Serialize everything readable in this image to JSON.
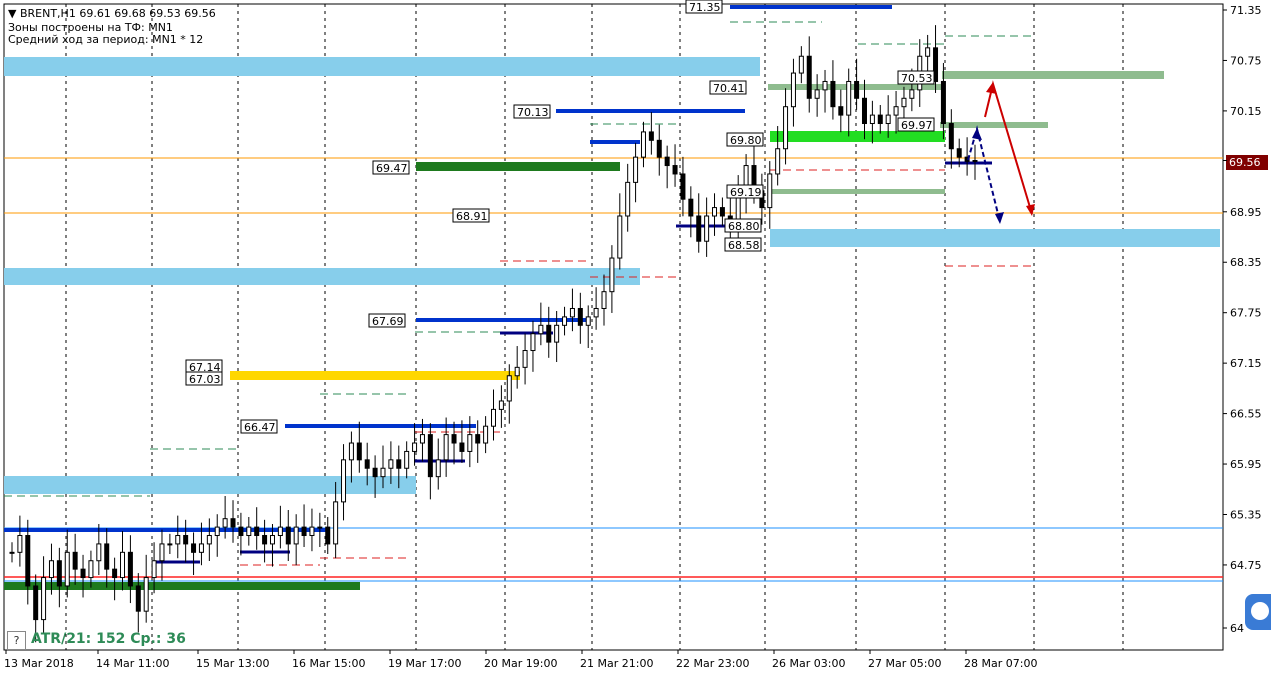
{
  "header": {
    "symbol_line": "BRENT,H1  69.61 69.68 69.53 69.56",
    "zones_line": "Зоны построены на ТФ: MN1",
    "avg_line": "Средний ход за период: MN1 * 12"
  },
  "atr_text": "ATR/21: 152  Ср.: 36",
  "help_box": "?",
  "colors": {
    "up_candle": "#000000",
    "grid": "#000000",
    "sky_zone": "#87ceeb",
    "dark_green_zone": "#1e7a1e",
    "lime_zone": "#22dd22",
    "sage_zone": "#8fbc8f",
    "gold_zone": "#ffd700",
    "blue_level": "#0033cc",
    "orange_line": "#ff9900",
    "red_line": "#ff2222",
    "price_box": "#800000",
    "arrow_red": "#cc0000",
    "arrow_blue": "#000080"
  },
  "chart_data": {
    "type": "candlestick",
    "symbol": "BRENT",
    "timeframe": "H1",
    "ylim": [
      63.95,
      71.4
    ],
    "y_ticks": [
      "71.35",
      "70.75",
      "70.15",
      "69.56",
      "68.95",
      "68.35",
      "67.75",
      "67.15",
      "66.55",
      "65.95",
      "65.35",
      "64.75",
      "64"
    ],
    "x_ticks": [
      "13 Mar 2018",
      "14 Mar 11:00",
      "15 Mar 13:00",
      "16 Mar 15:00",
      "19 Mar 17:00",
      "20 Mar 19:00",
      "21 Mar 21:00",
      "22 Mar 23:00",
      "26 Mar 03:00",
      "27 Mar 05:00",
      "28 Mar 07:00"
    ],
    "current_price": "69.56",
    "price_labels": [
      "71.35",
      "70.41",
      "70.13",
      "69.47",
      "69.80",
      "69.97",
      "70.53",
      "69.19",
      "68.91",
      "68.80",
      "68.58",
      "67.69",
      "67.14",
      "67.03",
      "66.47"
    ],
    "ohlc_path": [
      64.9,
      65.1,
      64.5,
      64.1,
      64.6,
      64.8,
      64.5,
      64.9,
      64.7,
      64.6,
      64.8,
      65.0,
      64.7,
      64.6,
      64.9,
      64.5,
      64.2,
      64.6,
      64.8,
      65.0,
      65.0,
      65.1,
      65.0,
      64.9,
      65.0,
      65.1,
      65.2,
      65.3,
      65.2,
      65.1,
      65.2,
      65.1,
      65.0,
      65.1,
      65.2,
      65.0,
      65.2,
      65.1,
      65.2,
      65.2,
      65.0,
      65.5,
      66.0,
      66.2,
      66.0,
      65.9,
      65.8,
      65.9,
      66.0,
      65.9,
      66.1,
      66.2,
      66.3,
      65.8,
      66.0,
      66.3,
      66.2,
      66.1,
      66.3,
      66.2,
      66.4,
      66.6,
      66.7,
      67.0,
      67.1,
      67.3,
      67.5,
      67.6,
      67.4,
      67.6,
      67.7,
      67.8,
      67.6,
      67.7,
      67.8,
      68.0,
      68.4,
      68.9,
      69.3,
      69.6,
      69.9,
      69.8,
      69.6,
      69.5,
      69.4,
      69.1,
      68.9,
      68.6,
      68.9,
      69.0,
      68.9,
      68.8,
      69.2,
      69.5,
      69.2,
      69.0,
      69.4,
      69.7,
      70.2,
      70.6,
      70.8,
      70.3,
      70.4,
      70.5,
      70.2,
      70.1,
      70.5,
      70.3,
      70.0,
      70.1,
      70.0,
      70.1,
      70.2,
      70.3,
      70.4,
      70.8,
      70.9,
      70.5,
      70.0,
      69.7,
      69.6,
      69.55,
      69.56
    ],
    "forecast": [
      "up-then-down arrow (red)",
      "small up-then-down arrow (blue)"
    ]
  }
}
